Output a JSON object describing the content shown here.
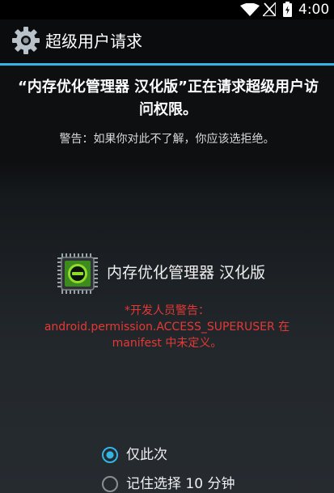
{
  "status_bar": {
    "time": "4:00",
    "icons": [
      "wifi-icon",
      "no-signal-icon",
      "battery-charging-icon"
    ]
  },
  "header": {
    "title": "超级用户请求",
    "icon": "gear-icon"
  },
  "request": {
    "message": "“内存优化管理器 汉化版”正在请求超级用户访问权限。",
    "warning": "警告：如果你对此不了解，你应该选拒绝。"
  },
  "app": {
    "name": "内存优化管理器 汉化版",
    "icon": "chip-icon",
    "dev_warning_title": "*开发人员警告：",
    "dev_warning_body_1": "android.permission.ACCESS_SUPERUSER 在",
    "dev_warning_body_2": "manifest 中未定义。"
  },
  "options": {
    "once_label": "仅此次",
    "remember_label": "记住选择 10 分钟",
    "selected": "once"
  },
  "colors": {
    "accent": "#33b5e5",
    "warning_red": "#e53935",
    "background": "#1a1d21"
  }
}
